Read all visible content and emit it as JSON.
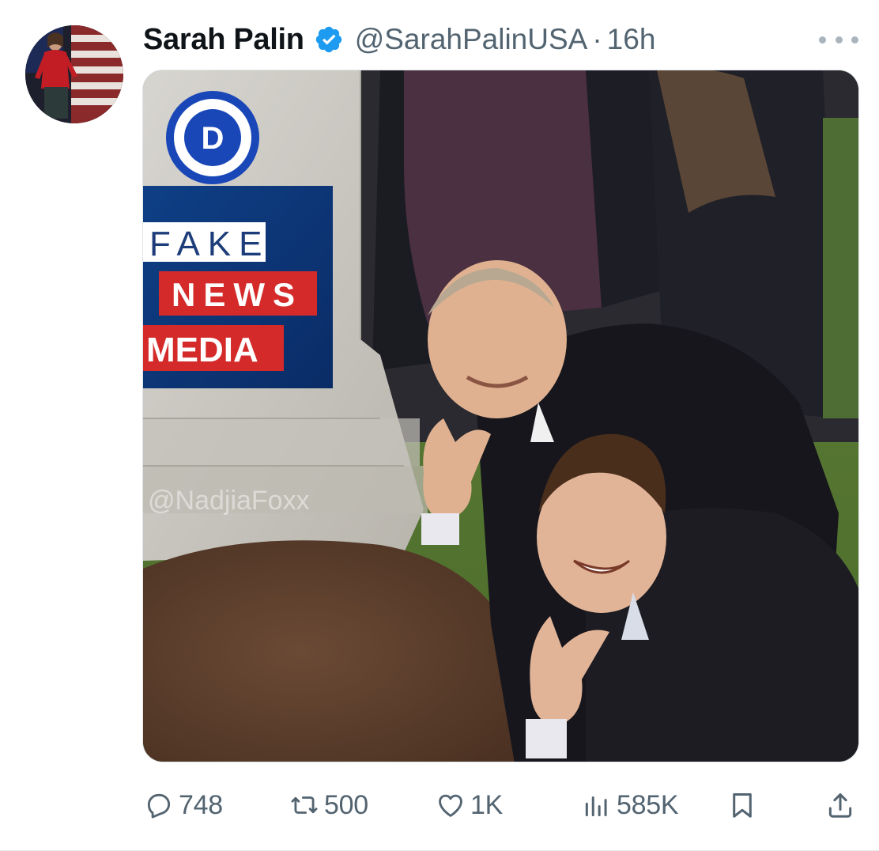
{
  "tweet": {
    "author_name": "Sarah Palin",
    "handle": "@SarahPalinUSA",
    "separator": "·",
    "time": "16h",
    "verified": true
  },
  "media": {
    "party_badge_letter": "D",
    "sign_lines": [
      "FAKE",
      "NEWS",
      "MEDIA"
    ],
    "watermark": "@NadjiaFoxx"
  },
  "actions": {
    "replies": "748",
    "reposts": "500",
    "likes": "1K",
    "views": "585K"
  },
  "colors": {
    "verified_badge": "#1d9bf0",
    "secondary_text": "#536471",
    "primary_text": "#0f1419",
    "party_blue": "#1a47b8",
    "sign_red": "#d42a2a"
  },
  "icons": {
    "reply": "speech-bubble-icon",
    "repost": "repost-arrows-icon",
    "like": "heart-icon",
    "views": "bar-chart-icon",
    "bookmark": "bookmark-icon",
    "share": "share-upload-icon",
    "more": "more-dots-icon",
    "verified": "verified-badge-icon"
  }
}
